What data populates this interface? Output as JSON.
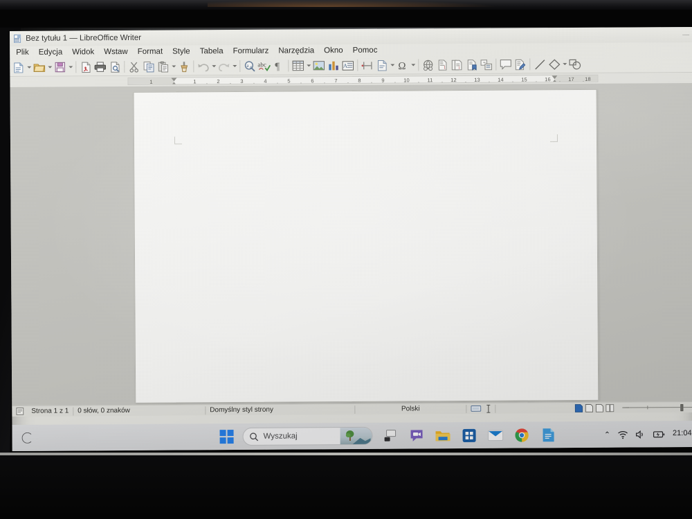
{
  "window": {
    "title": "Bez tytułu 1 — LibreOffice Writer",
    "app_icon": "writer-document-icon",
    "minimize_label": "—",
    "maximize_label": "□",
    "close_label": "✕"
  },
  "menubar": {
    "items": [
      {
        "label": "Plik",
        "name": "menu-plik"
      },
      {
        "label": "Edycja",
        "name": "menu-edycja"
      },
      {
        "label": "Widok",
        "name": "menu-widok"
      },
      {
        "label": "Wstaw",
        "name": "menu-wstaw"
      },
      {
        "label": "Format",
        "name": "menu-format"
      },
      {
        "label": "Style",
        "name": "menu-style"
      },
      {
        "label": "Tabela",
        "name": "menu-tabela"
      },
      {
        "label": "Formularz",
        "name": "menu-formularz"
      },
      {
        "label": "Narzędzia",
        "name": "menu-narzedzia"
      },
      {
        "label": "Okno",
        "name": "menu-okno"
      },
      {
        "label": "Pomoc",
        "name": "menu-pomoc"
      }
    ]
  },
  "toolbar": {
    "buttons": [
      "new-document-icon",
      "open-file-icon",
      "save-icon",
      "export-pdf-icon",
      "print-icon",
      "print-preview-icon",
      "cut-icon",
      "copy-icon",
      "paste-icon",
      "clone-formatting-icon",
      "undo-icon",
      "redo-icon",
      "find-replace-icon",
      "spelling-icon",
      "formatting-marks-icon",
      "insert-table-icon",
      "insert-image-icon",
      "insert-chart-icon",
      "insert-text-box-icon",
      "page-break-icon",
      "insert-field-icon",
      "special-character-icon",
      "hyperlink-icon",
      "footnote-icon",
      "endnote-icon",
      "bookmark-icon",
      "cross-reference-icon",
      "comment-icon",
      "track-changes-icon",
      "line-icon",
      "basic-shapes-icon",
      "show-draw-functions-icon"
    ]
  },
  "ruler": {
    "left_label": "1",
    "numbers": [
      "1",
      "2",
      "3",
      "4",
      "5",
      "6",
      "7",
      "8",
      "9",
      "10",
      "11",
      "12",
      "13",
      "14",
      "15",
      "16",
      "17",
      "18"
    ],
    "unit": "cm"
  },
  "document": {
    "page_content": "",
    "text_boundary": "visible"
  },
  "statusbar": {
    "page_icon": "page-style-icon",
    "page_info": "Strona 1 z 1",
    "word_count": "0 słów, 0 znaków",
    "page_style": "Domyślny styl strony",
    "language": "Polski",
    "insert_mode_icon": "selection-mode-icon",
    "cursor_icon": "text-cursor-icon",
    "view_single_icon": "single-page-view-icon",
    "view_multi_icon": "multi-page-view-icon",
    "view_book_icon": "book-view-icon",
    "zoom_minus": "—",
    "zoom_plus": "+"
  },
  "taskbar": {
    "start_label": "start-button",
    "search_placeholder": "Wyszukaj",
    "search_icon": "search-icon",
    "search_thumbnail": "nature-landscape-thumbnail",
    "items": [
      {
        "name": "taskbar-task-view",
        "label": "task-view-icon"
      },
      {
        "name": "taskbar-chat",
        "label": "chat-teams-icon"
      },
      {
        "name": "taskbar-file-explorer",
        "label": "file-explorer-icon"
      },
      {
        "name": "taskbar-microsoft-store",
        "label": "microsoft-store-icon"
      },
      {
        "name": "taskbar-mail",
        "label": "mail-icon"
      },
      {
        "name": "taskbar-chrome",
        "label": "google-chrome-icon"
      },
      {
        "name": "taskbar-libreoffice-writer",
        "label": "libreoffice-writer-icon"
      }
    ],
    "tray": {
      "overflow_icon": "chevron-up-icon",
      "wifi_icon": "wifi-icon",
      "volume_icon": "speaker-icon",
      "battery_icon": "battery-charging-icon",
      "clock": "21:04"
    }
  },
  "colors": {
    "accent": "#2680eb",
    "chrome_bg": "#ecece7",
    "doc_bg": "#c9c9c4",
    "page": "#fcfcfa",
    "taskbar": "#dfe0e2"
  }
}
